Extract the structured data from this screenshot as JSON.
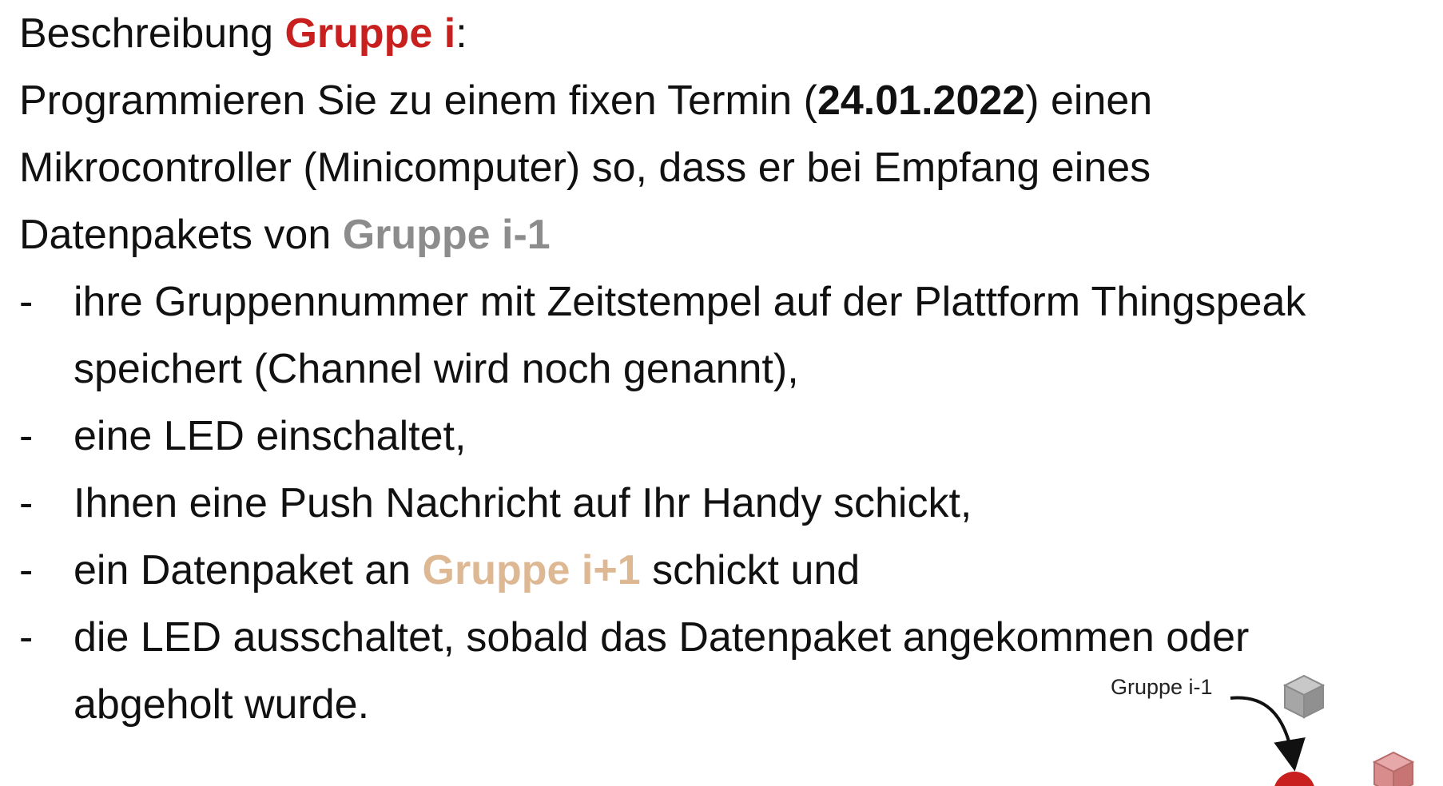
{
  "heading": {
    "prefix": "Beschreibung ",
    "group": "Gruppe i",
    "suffix": ":"
  },
  "intro": {
    "line1_a": "Programmieren Sie zu einem fixen Termin (",
    "date": "24.01.2022",
    "line1_b": ") einen",
    "line2": "Mikrocontroller (Minicomputer) so, dass er bei Empfang eines",
    "line3_a": "Datenpakets von ",
    "line3_group": "Gruppe i-1"
  },
  "bullets": {
    "dash": "-",
    "b1_line1": "ihre Gruppennummer mit Zeitstempel auf der Plattform Thingspeak",
    "b1_line2": "speichert (Channel wird noch genannt),",
    "b2": "eine LED einschaltet,",
    "b3": "Ihnen eine Push Nachricht auf Ihr Handy schickt,",
    "b4_a": "ein Datenpaket an ",
    "b4_group": "Gruppe i+1",
    "b4_b": " schickt und",
    "b5_line1": "die LED ausschaltet, sobald das Datenpaket angekommen oder",
    "b5_line2": "abgeholt wurde."
  },
  "diagram": {
    "label": "Gruppe i-1",
    "icons": [
      "package-icon",
      "node-dot-icon",
      "package-icon"
    ],
    "colors": {
      "package_gray": "#a6a6a6",
      "package_red": "#d98c8c",
      "node": "#c8201e",
      "arrow": "#111111"
    }
  },
  "colors": {
    "group_current": "#c8201e",
    "group_prev": "#8c8c8c",
    "group_next": "#ddb892",
    "text": "#111111"
  }
}
